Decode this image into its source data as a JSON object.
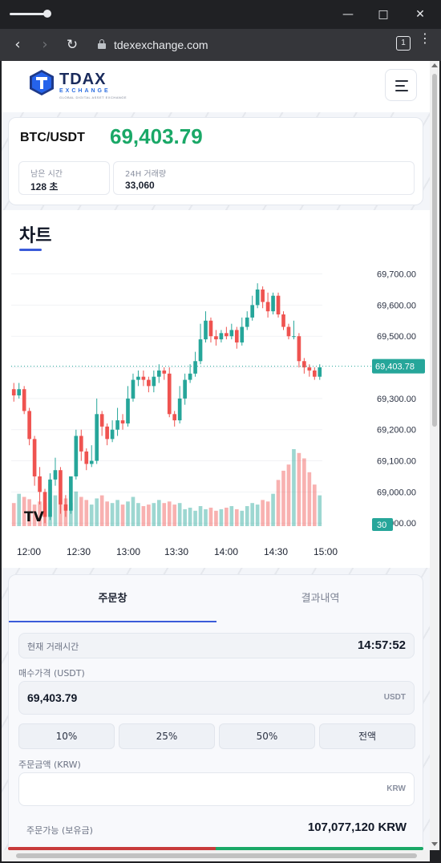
{
  "browser": {
    "url": "tdexexchange.com",
    "tab_count": "1"
  },
  "header": {
    "logo_title": "TDAX",
    "logo_sub": "EXCHANGE",
    "logo_tagline": "GLOBAL DIGITAL ASSET EXCHANGE",
    "menu_icon": "hamburger-menu-icon"
  },
  "ticker": {
    "pair": "BTC/USDT",
    "price": "69,403.79",
    "price_color": "#1aa867",
    "remaining_label": "남은 시간",
    "remaining_value": "128 초",
    "volume_label": "24H 거래량",
    "volume_value": "33,060"
  },
  "chart_section": {
    "title": "차트",
    "logo_glyph": "TV"
  },
  "chart_data": {
    "type": "candlestick",
    "x_ticks": [
      "12:00",
      "12:30",
      "13:00",
      "13:30",
      "14:00",
      "14:30",
      "15:00"
    ],
    "y_ticks": [
      "68,900.00",
      "69,000.00",
      "69,100.00",
      "69,200.00",
      "69,300.00",
      "69,400.00",
      "69,500.00",
      "69,600.00",
      "69,700.00"
    ],
    "ylim": [
      68880,
      69740
    ],
    "last_price_label": "69,403.78",
    "last_price": 69403.78,
    "countdown_label": "30",
    "up_color": "#26a69a",
    "down_color": "#ef5350",
    "candles": [
      [
        69330,
        69310,
        69350,
        69290
      ],
      [
        69310,
        69330,
        69350,
        69300
      ],
      [
        69330,
        69260,
        69340,
        69250
      ],
      [
        69260,
        69170,
        69270,
        69150
      ],
      [
        69170,
        69050,
        69180,
        69020
      ],
      [
        69050,
        69000,
        69080,
        68960
      ],
      [
        69000,
        68920,
        69010,
        68900
      ],
      [
        68920,
        69040,
        69060,
        68910
      ],
      [
        69040,
        69070,
        69110,
        69020
      ],
      [
        69070,
        68960,
        69080,
        68930
      ],
      [
        68960,
        68940,
        68990,
        68920
      ],
      [
        68940,
        69050,
        68960,
        68930
      ],
      [
        69050,
        69180,
        69200,
        69040
      ],
      [
        69180,
        69130,
        69200,
        69100
      ],
      [
        69130,
        69090,
        69140,
        69070
      ],
      [
        69090,
        69100,
        69150,
        69080
      ],
      [
        69100,
        69250,
        69300,
        69090
      ],
      [
        69250,
        69210,
        69260,
        69180
      ],
      [
        69210,
        69170,
        69220,
        69150
      ],
      [
        69170,
        69200,
        69230,
        69160
      ],
      [
        69200,
        69230,
        69270,
        69180
      ],
      [
        69230,
        69220,
        69250,
        69200
      ],
      [
        69220,
        69300,
        69340,
        69210
      ],
      [
        69300,
        69360,
        69380,
        69290
      ],
      [
        69360,
        69370,
        69390,
        69340
      ],
      [
        69370,
        69360,
        69390,
        69340
      ],
      [
        69360,
        69340,
        69370,
        69320
      ],
      [
        69340,
        69370,
        69390,
        69320
      ],
      [
        69370,
        69390,
        69410,
        69350
      ],
      [
        69390,
        69380,
        69400,
        69360
      ],
      [
        69380,
        69250,
        69400,
        69240
      ],
      [
        69250,
        69230,
        69260,
        69210
      ],
      [
        69230,
        69300,
        69340,
        69220
      ],
      [
        69300,
        69360,
        69380,
        69280
      ],
      [
        69360,
        69380,
        69410,
        69350
      ],
      [
        69380,
        69420,
        69450,
        69370
      ],
      [
        69420,
        69490,
        69540,
        69410
      ],
      [
        69490,
        69550,
        69580,
        69480
      ],
      [
        69550,
        69500,
        69560,
        69480
      ],
      [
        69500,
        69490,
        69520,
        69470
      ],
      [
        69490,
        69510,
        69520,
        69480
      ],
      [
        69510,
        69500,
        69530,
        69490
      ],
      [
        69500,
        69520,
        69540,
        69490
      ],
      [
        69520,
        69480,
        69530,
        69460
      ],
      [
        69480,
        69530,
        69560,
        69470
      ],
      [
        69530,
        69560,
        69580,
        69520
      ],
      [
        69560,
        69600,
        69630,
        69550
      ],
      [
        69600,
        69650,
        69670,
        69590
      ],
      [
        69650,
        69610,
        69660,
        69590
      ],
      [
        69610,
        69580,
        69640,
        69560
      ],
      [
        69580,
        69630,
        69640,
        69570
      ],
      [
        69630,
        69570,
        69640,
        69560
      ],
      [
        69570,
        69530,
        69580,
        69520
      ],
      [
        69530,
        69500,
        69540,
        69490
      ],
      [
        69500,
        69500,
        69550,
        69490
      ],
      [
        69500,
        69420,
        69510,
        69400
      ],
      [
        69420,
        69400,
        69430,
        69380
      ],
      [
        69400,
        69390,
        69410,
        69370
      ],
      [
        69390,
        69370,
        69400,
        69360
      ],
      [
        69370,
        69400,
        69410,
        69360
      ]
    ],
    "volumes": [
      0.3,
      0.42,
      0.38,
      0.35,
      0.28,
      0.32,
      0.3,
      0.55,
      0.4,
      0.34,
      0.36,
      0.3,
      0.45,
      0.38,
      0.34,
      0.28,
      0.36,
      0.4,
      0.32,
      0.3,
      0.34,
      0.28,
      0.32,
      0.38,
      0.3,
      0.26,
      0.28,
      0.3,
      0.34,
      0.3,
      0.32,
      0.28,
      0.3,
      0.22,
      0.24,
      0.2,
      0.26,
      0.22,
      0.24,
      0.2,
      0.22,
      0.24,
      0.26,
      0.22,
      0.2,
      0.26,
      0.3,
      0.28,
      0.34,
      0.32,
      0.42,
      0.6,
      0.72,
      0.8,
      1.0,
      0.95,
      0.88,
      0.7,
      0.54,
      0.4
    ]
  },
  "order": {
    "tab_order": "주문창",
    "tab_results": "결과내역",
    "trade_time_label": "현재 거래시간",
    "trade_time": "14:57:52",
    "buy_price_label": "매수가격 (USDT)",
    "buy_price": "69,403.79",
    "buy_unit": "USDT",
    "pct_buttons": [
      "10%",
      "25%",
      "50%",
      "전액"
    ],
    "amount_label": "주문금액 (KRW)",
    "amount_unit": "KRW",
    "available_label": "주문가능 (보유금)",
    "available_value": "107,077,120 KRW"
  }
}
